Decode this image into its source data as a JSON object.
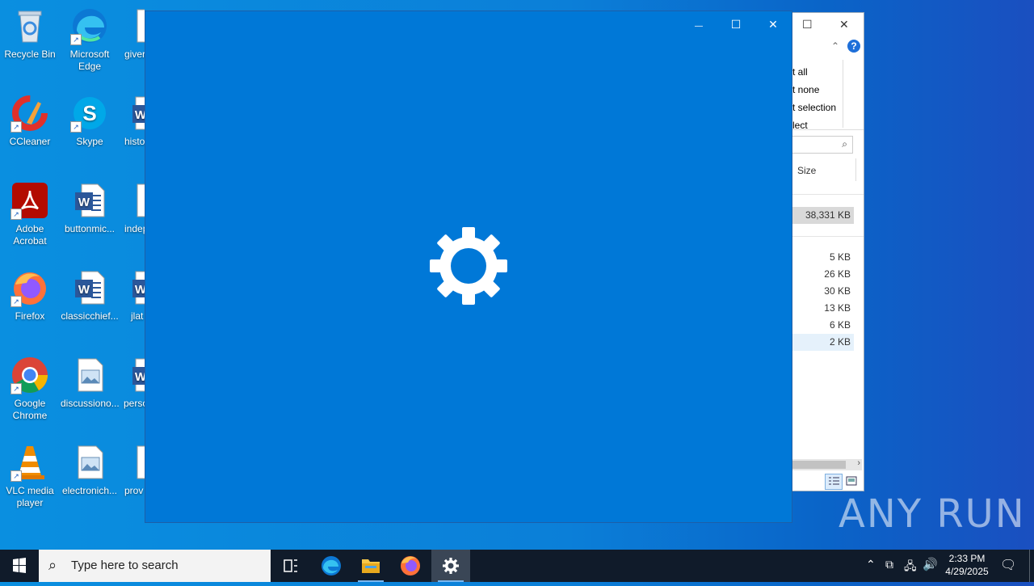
{
  "desktop": {
    "icons": [
      {
        "label": "Recycle Bin"
      },
      {
        "label": "Microsoft Edge"
      },
      {
        "label": "giver"
      },
      {
        "label": "CCleaner"
      },
      {
        "label": "Skype"
      },
      {
        "label": "histo"
      },
      {
        "label": "Adobe Acrobat"
      },
      {
        "label": "buttonmic..."
      },
      {
        "label": "indep"
      },
      {
        "label": "Firefox"
      },
      {
        "label": "classicchief..."
      },
      {
        "label": "jlat"
      },
      {
        "label": "Google Chrome"
      },
      {
        "label": "discussiono..."
      },
      {
        "label": "perso"
      },
      {
        "label": "VLC media player"
      },
      {
        "label": "electronich..."
      },
      {
        "label": "prov"
      }
    ]
  },
  "explorer": {
    "ribbon": [
      "t all",
      "t none",
      "t selection",
      "lect"
    ],
    "size_header": "Size",
    "selected_size": "38,331 KB",
    "sizes": [
      "5 KB",
      "26 KB",
      "30 KB",
      "13 KB",
      "6 KB",
      "2 KB"
    ],
    "help_glyph": "?"
  },
  "settings_window": {
    "minimize_glyph": "—",
    "maximize_glyph": "☐",
    "close_glyph": "✕"
  },
  "watermark": "ANY RUN",
  "taskbar": {
    "search_placeholder": "Type here to search",
    "time": "2:33 PM",
    "date": "4/29/2025"
  },
  "colors": {
    "settings_bg": "#0078d7",
    "taskbar_bg": "#101b2a"
  }
}
